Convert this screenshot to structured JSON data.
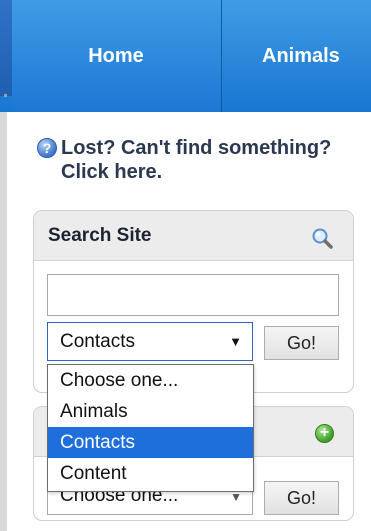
{
  "nav": {
    "tabs": [
      {
        "label": "Home"
      },
      {
        "label": "Animals"
      }
    ]
  },
  "lost_link": {
    "icon": "help-icon",
    "text": "Lost? Can't find something? Click here."
  },
  "search_panel": {
    "title": "Search Site",
    "search_icon": "magnifier-icon",
    "input_value": "",
    "select": {
      "selected": "Contacts",
      "options": [
        "Choose one...",
        "Animals",
        "Contacts",
        "Content"
      ]
    },
    "go_label": "Go!"
  },
  "second_panel": {
    "add_icon": "plus-icon",
    "select_value": "Choose one...",
    "go_label": "Go!"
  },
  "colors": {
    "nav_blue": "#1976d2",
    "selection_blue": "#1e6fdc",
    "panel_header": "#ececec"
  }
}
